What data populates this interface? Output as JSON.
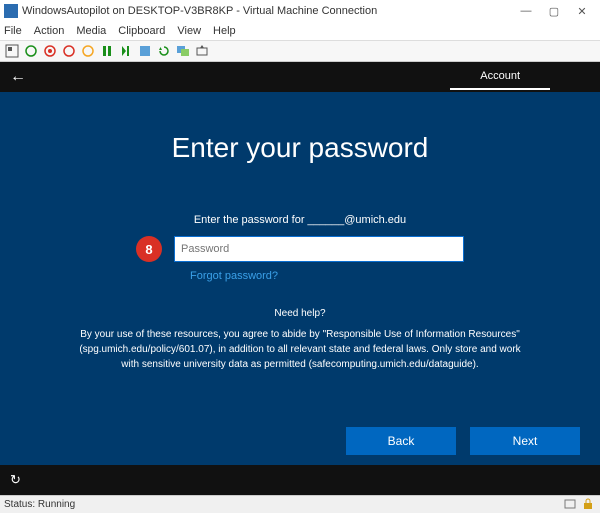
{
  "window": {
    "title": "WindowsAutopilot on DESKTOP-V3BR8KP - Virtual Machine Connection"
  },
  "menu": {
    "file": "File",
    "action": "Action",
    "media": "Media",
    "clipboard": "Clipboard",
    "view": "View",
    "help": "Help"
  },
  "oobe": {
    "step": "Account",
    "heading": "Enter your password",
    "prompt": "Enter the password for ______@umich.edu",
    "placeholder": "Password",
    "forgot": "Forgot password?",
    "needhelp": "Need help?",
    "legal": "By your use of these resources, you agree to abide by \"Responsible Use of Information Resources\" (spg.umich.edu/policy/601.07), in addition to all relevant state and federal laws. Only store and work with sensitive university data as permitted (safecomputing.umich.edu/dataguide).",
    "back": "Back",
    "next": "Next"
  },
  "annotation": {
    "badge": "8"
  },
  "status": {
    "text": "Status: Running"
  }
}
